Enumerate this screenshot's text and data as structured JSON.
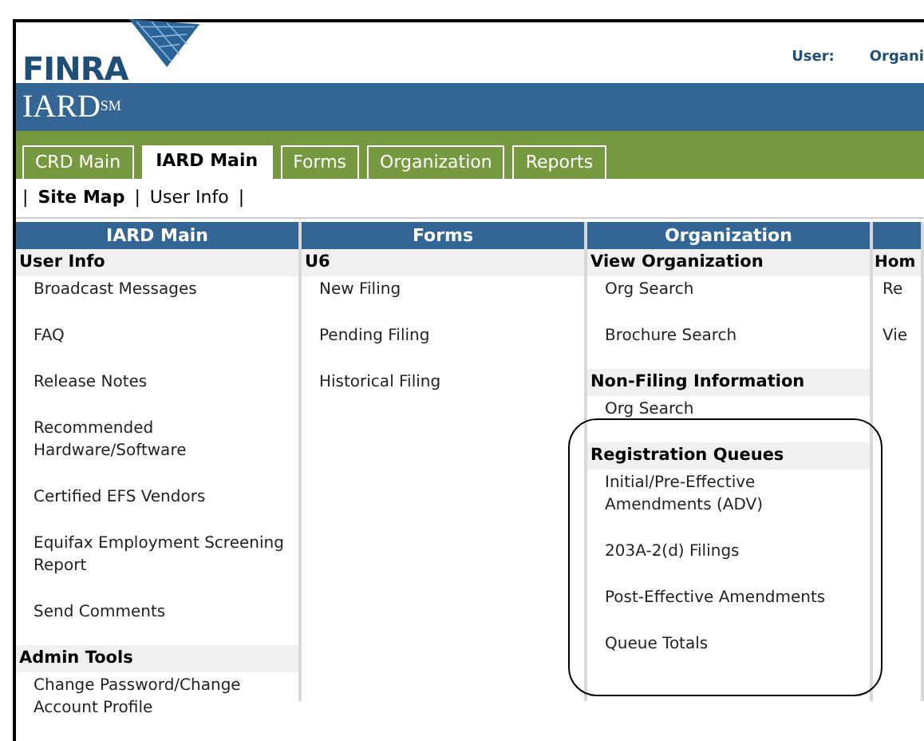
{
  "header": {
    "logo": "FINRA",
    "user_label": "User:",
    "org_label": "Organi"
  },
  "banner": {
    "title": "IARD$^{SM}$"
  },
  "tabs": [
    {
      "label": "CRD Main",
      "selected": false
    },
    {
      "label": "IARD Main",
      "selected": true
    },
    {
      "label": "Forms",
      "selected": false
    },
    {
      "label": "Organization",
      "selected": false
    },
    {
      "label": "Reports",
      "selected": false
    }
  ],
  "sub_nav": {
    "separator": "|",
    "items": [
      {
        "label": "Site Map",
        "selected": true
      },
      {
        "label": "User Info",
        "selected": false
      }
    ]
  },
  "columns": [
    {
      "title": "IARD Main",
      "sections": [
        {
          "heading": "User Info",
          "circled": false,
          "links": [
            "Broadcast Messages",
            "FAQ",
            "Release Notes",
            "Recommended Hardware/Software",
            "Certified EFS Vendors",
            "Equifax Employment Screening Report",
            "Send Comments"
          ]
        },
        {
          "heading": "Admin Tools",
          "circled": false,
          "links": [
            "Change Password/Change Account Profile"
          ]
        }
      ]
    },
    {
      "title": "Forms",
      "sections": [
        {
          "heading": "U6",
          "circled": false,
          "links": [
            "New Filing",
            "Pending Filing",
            "Historical Filing"
          ]
        }
      ]
    },
    {
      "title": "Organization",
      "sections": [
        {
          "heading": "View Organization",
          "circled": false,
          "links": [
            "Org Search",
            "Brochure Search"
          ]
        },
        {
          "heading": "Non-Filing Information",
          "circled": false,
          "links": [
            "Org Search"
          ]
        },
        {
          "heading": "Registration Queues",
          "circled": true,
          "links": [
            "Initial/Pre-Effective Amendments (ADV)",
            "203A-2(d) Filings",
            "Post-Effective Amendments",
            "Queue Totals"
          ]
        }
      ]
    },
    {
      "sections": [
        {
          "heading": "Hom",
          "circled": false,
          "links": [
            "Re",
            "Vie"
          ]
        }
      ]
    }
  ]
}
